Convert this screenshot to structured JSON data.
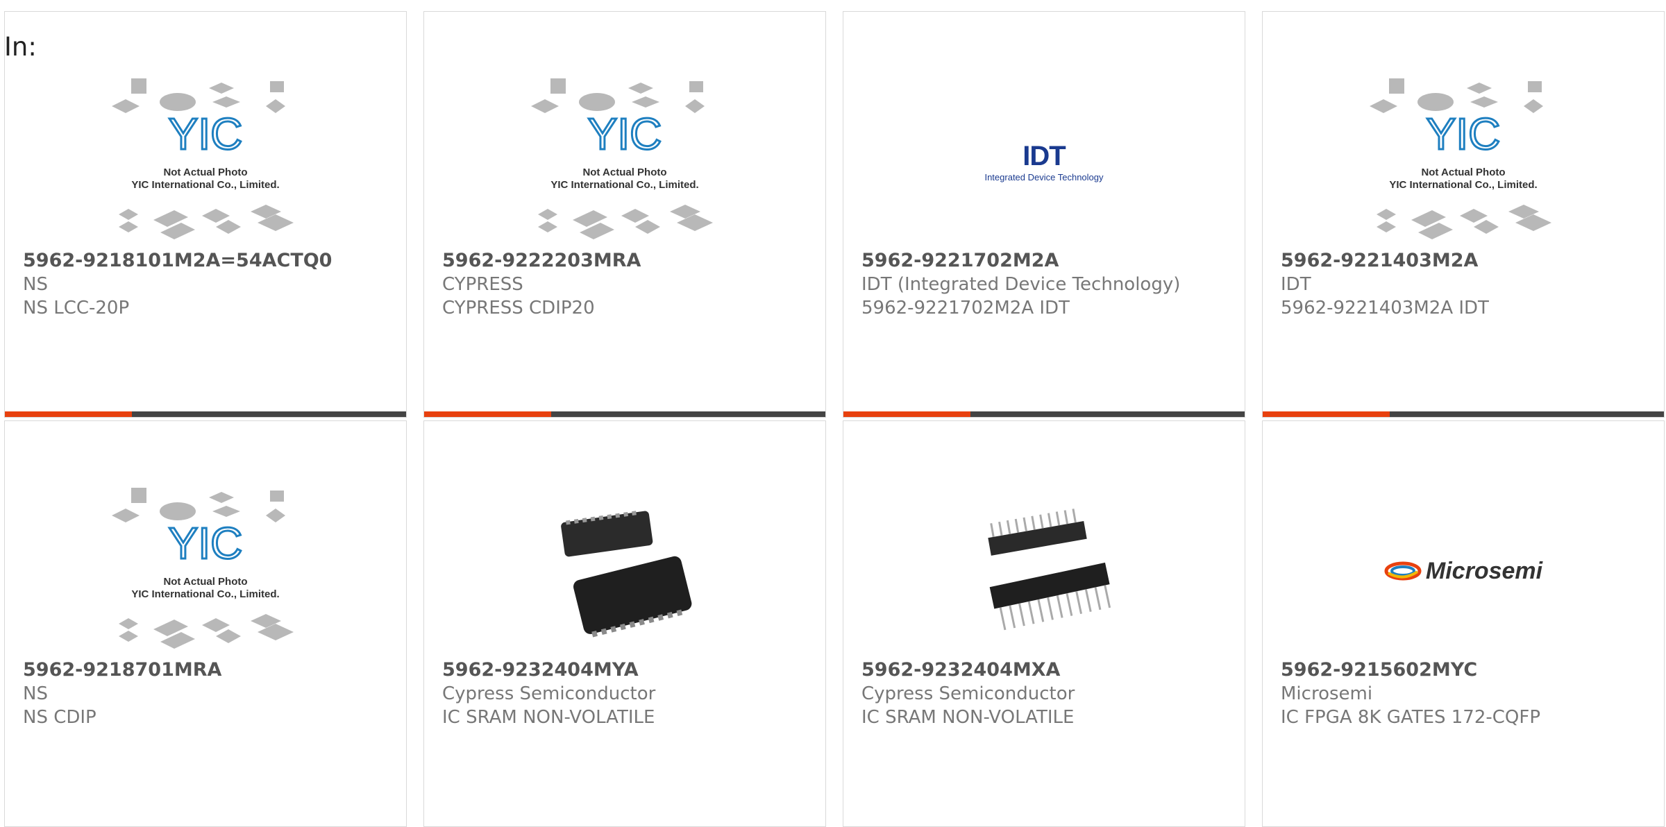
{
  "header": {
    "in_label": "In:"
  },
  "products": [
    {
      "part_number": "5962-9218101M2A=54ACTQ0",
      "manufacturer": "NS",
      "description": "NS LCC-20P",
      "image": "yic-placeholder"
    },
    {
      "part_number": "5962-9222203MRA",
      "manufacturer": "CYPRESS",
      "description": "CYPRESS CDIP20",
      "image": "yic-placeholder"
    },
    {
      "part_number": "5962-9221702M2A",
      "manufacturer": "IDT (Integrated Device Technology)",
      "description": "5962-9221702M2A IDT",
      "image": "idt-logo"
    },
    {
      "part_number": "5962-9221403M2A",
      "manufacturer": "IDT",
      "description": "5962-9221403M2A IDT",
      "image": "yic-placeholder"
    },
    {
      "part_number": "5962-9218701MRA",
      "manufacturer": "NS",
      "description": "NS CDIP",
      "image": "yic-placeholder"
    },
    {
      "part_number": "5962-9232404MYA",
      "manufacturer": "Cypress Semiconductor",
      "description": "IC SRAM NON-VOLATILE",
      "image": "lcc-package"
    },
    {
      "part_number": "5962-9232404MXA",
      "manufacturer": "Cypress Semiconductor",
      "description": "IC SRAM NON-VOLATILE",
      "image": "dip-package"
    },
    {
      "part_number": "5962-9215602MYC",
      "manufacturer": "Microsemi",
      "description": "IC FPGA 8K GATES 172-CQFP",
      "image": "microsemi-logo"
    }
  ],
  "yic": {
    "caption1": "Not Actual Photo",
    "caption2": "YIC International Co., Limited.",
    "logo_text": "YIC"
  },
  "logos": {
    "idt_mark": "IDT",
    "idt_sub": "Integrated Device Technology",
    "microsemi": "Microsemi"
  },
  "colors": {
    "accent": "#e8410f",
    "bar": "#444444",
    "idt_blue": "#1a3a8f",
    "yic_blue": "#1e7fc0"
  }
}
